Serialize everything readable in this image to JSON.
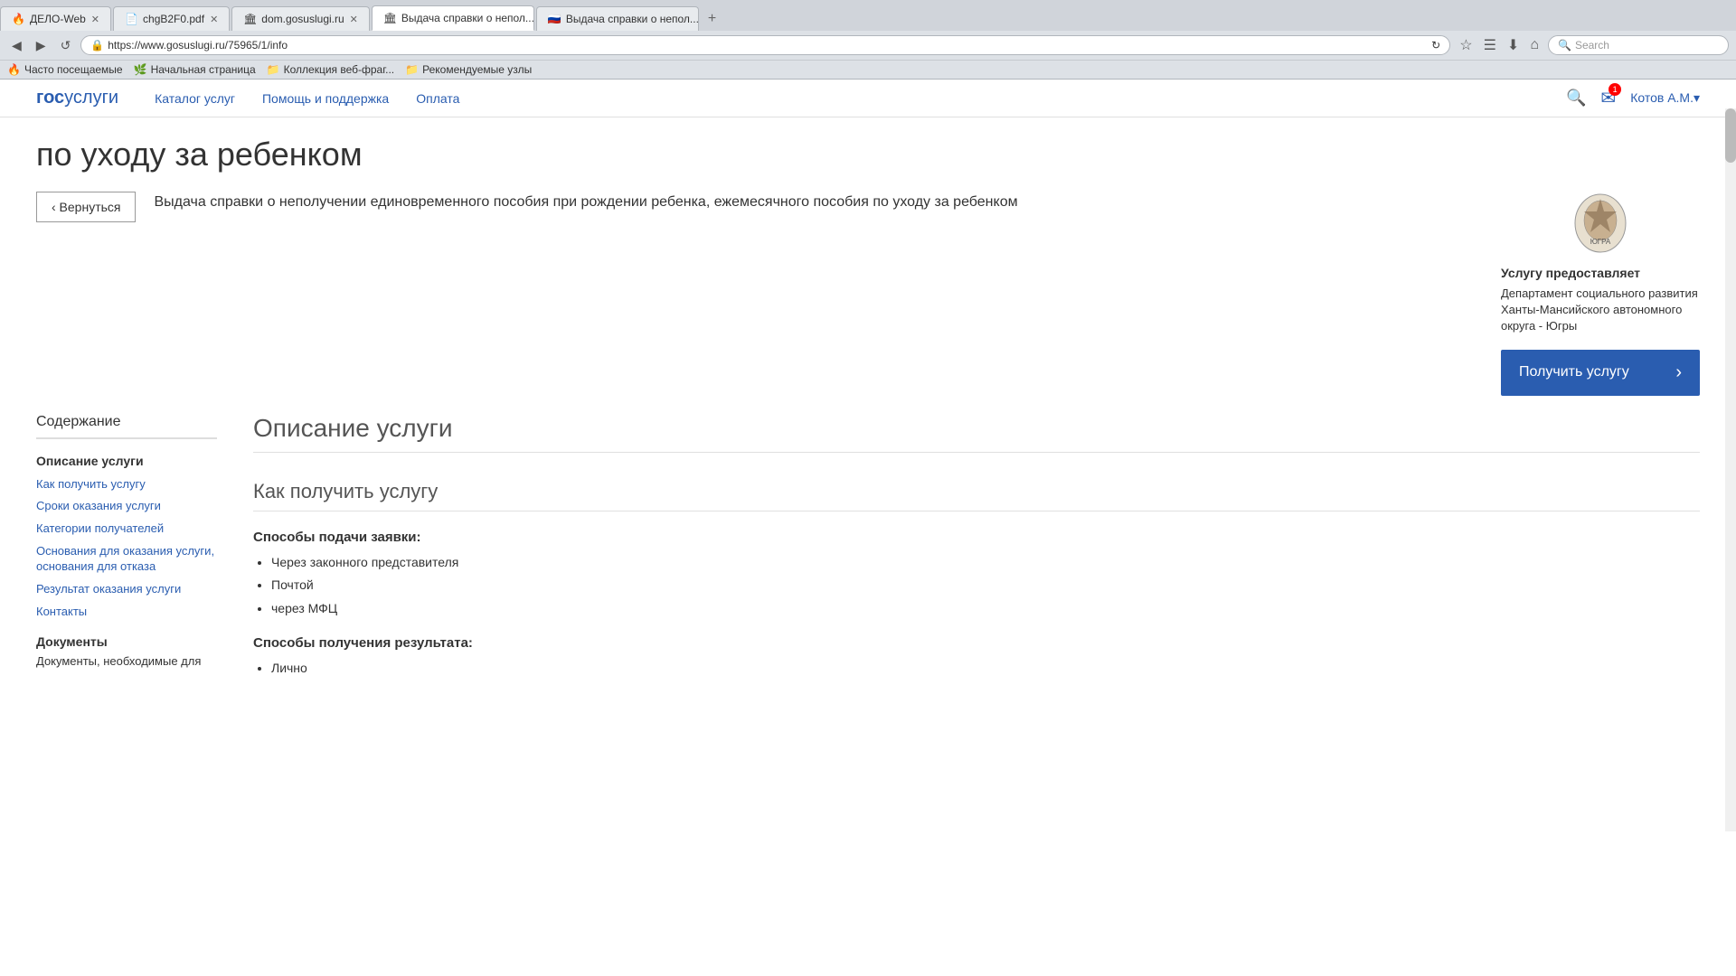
{
  "browser": {
    "tabs": [
      {
        "id": "tab1",
        "favicon": "🔥",
        "title": "ДЕЛО-Web",
        "active": false,
        "closeable": true
      },
      {
        "id": "tab2",
        "favicon": "📄",
        "title": "chgB2F0.pdf",
        "active": false,
        "closeable": true
      },
      {
        "id": "tab3",
        "favicon": "🏛",
        "title": "dom.gosuslugi.ru",
        "active": false,
        "closeable": true
      },
      {
        "id": "tab4",
        "favicon": "🏛",
        "title": "Выдача справки о непол...",
        "active": true,
        "closeable": true
      },
      {
        "id": "tab5",
        "favicon": "🇷🇺",
        "title": "Выдача справки о непол...",
        "active": false,
        "closeable": true
      }
    ],
    "url": "https://www.gosuslugi.ru/75965/1/info",
    "search_placeholder": "Search"
  },
  "bookmarks": [
    {
      "icon": "🔥",
      "label": "Часто посещаемые"
    },
    {
      "icon": "🌿",
      "label": "Начальная страница"
    },
    {
      "icon": "📁",
      "label": "Коллекция веб-фраг..."
    },
    {
      "icon": "📁",
      "label": "Рекомендуемые узлы"
    }
  ],
  "header": {
    "logo_gos": "гос",
    "logo_uslugi": "услуги",
    "nav": [
      {
        "label": "Каталог услуг"
      },
      {
        "label": "Помощь и поддержка"
      },
      {
        "label": "Оплата"
      }
    ],
    "badge_count": "1",
    "user_name": "Котов А.М.▾"
  },
  "page": {
    "title_line1": "по уходу за ребенком",
    "back_btn": "‹ Вернуться",
    "service_title": "Выдача справки о неполучении единовременного пособия при рождении ребенка, ежемесячного пособия по уходу за ребенком",
    "provider": {
      "label": "Услугу предоставляет",
      "name": "Департамент социального развития Ханты-Мансийского автономного округа - Югры"
    },
    "get_service_btn": "Получить услугу",
    "sidebar": {
      "title": "Содержание",
      "section_title": "Описание услуги",
      "links": [
        "Как получить услугу",
        "Сроки оказания услуги",
        "Категории получателей",
        "Основания для оказания услуги, основания для отказа",
        "Результат оказания услуги",
        "Контакты"
      ],
      "docs_title": "Документы",
      "docs_sub": "Документы, необходимые для"
    },
    "main": {
      "section_heading": "Описание услуги",
      "subsection_heading": "Как получить услугу",
      "ways_label": "Способы подачи заявки:",
      "ways": [
        "Через законного представителя",
        "Почтой",
        "через МФЦ"
      ],
      "result_label": "Способы получения результата:",
      "result": [
        "Лично"
      ]
    }
  }
}
